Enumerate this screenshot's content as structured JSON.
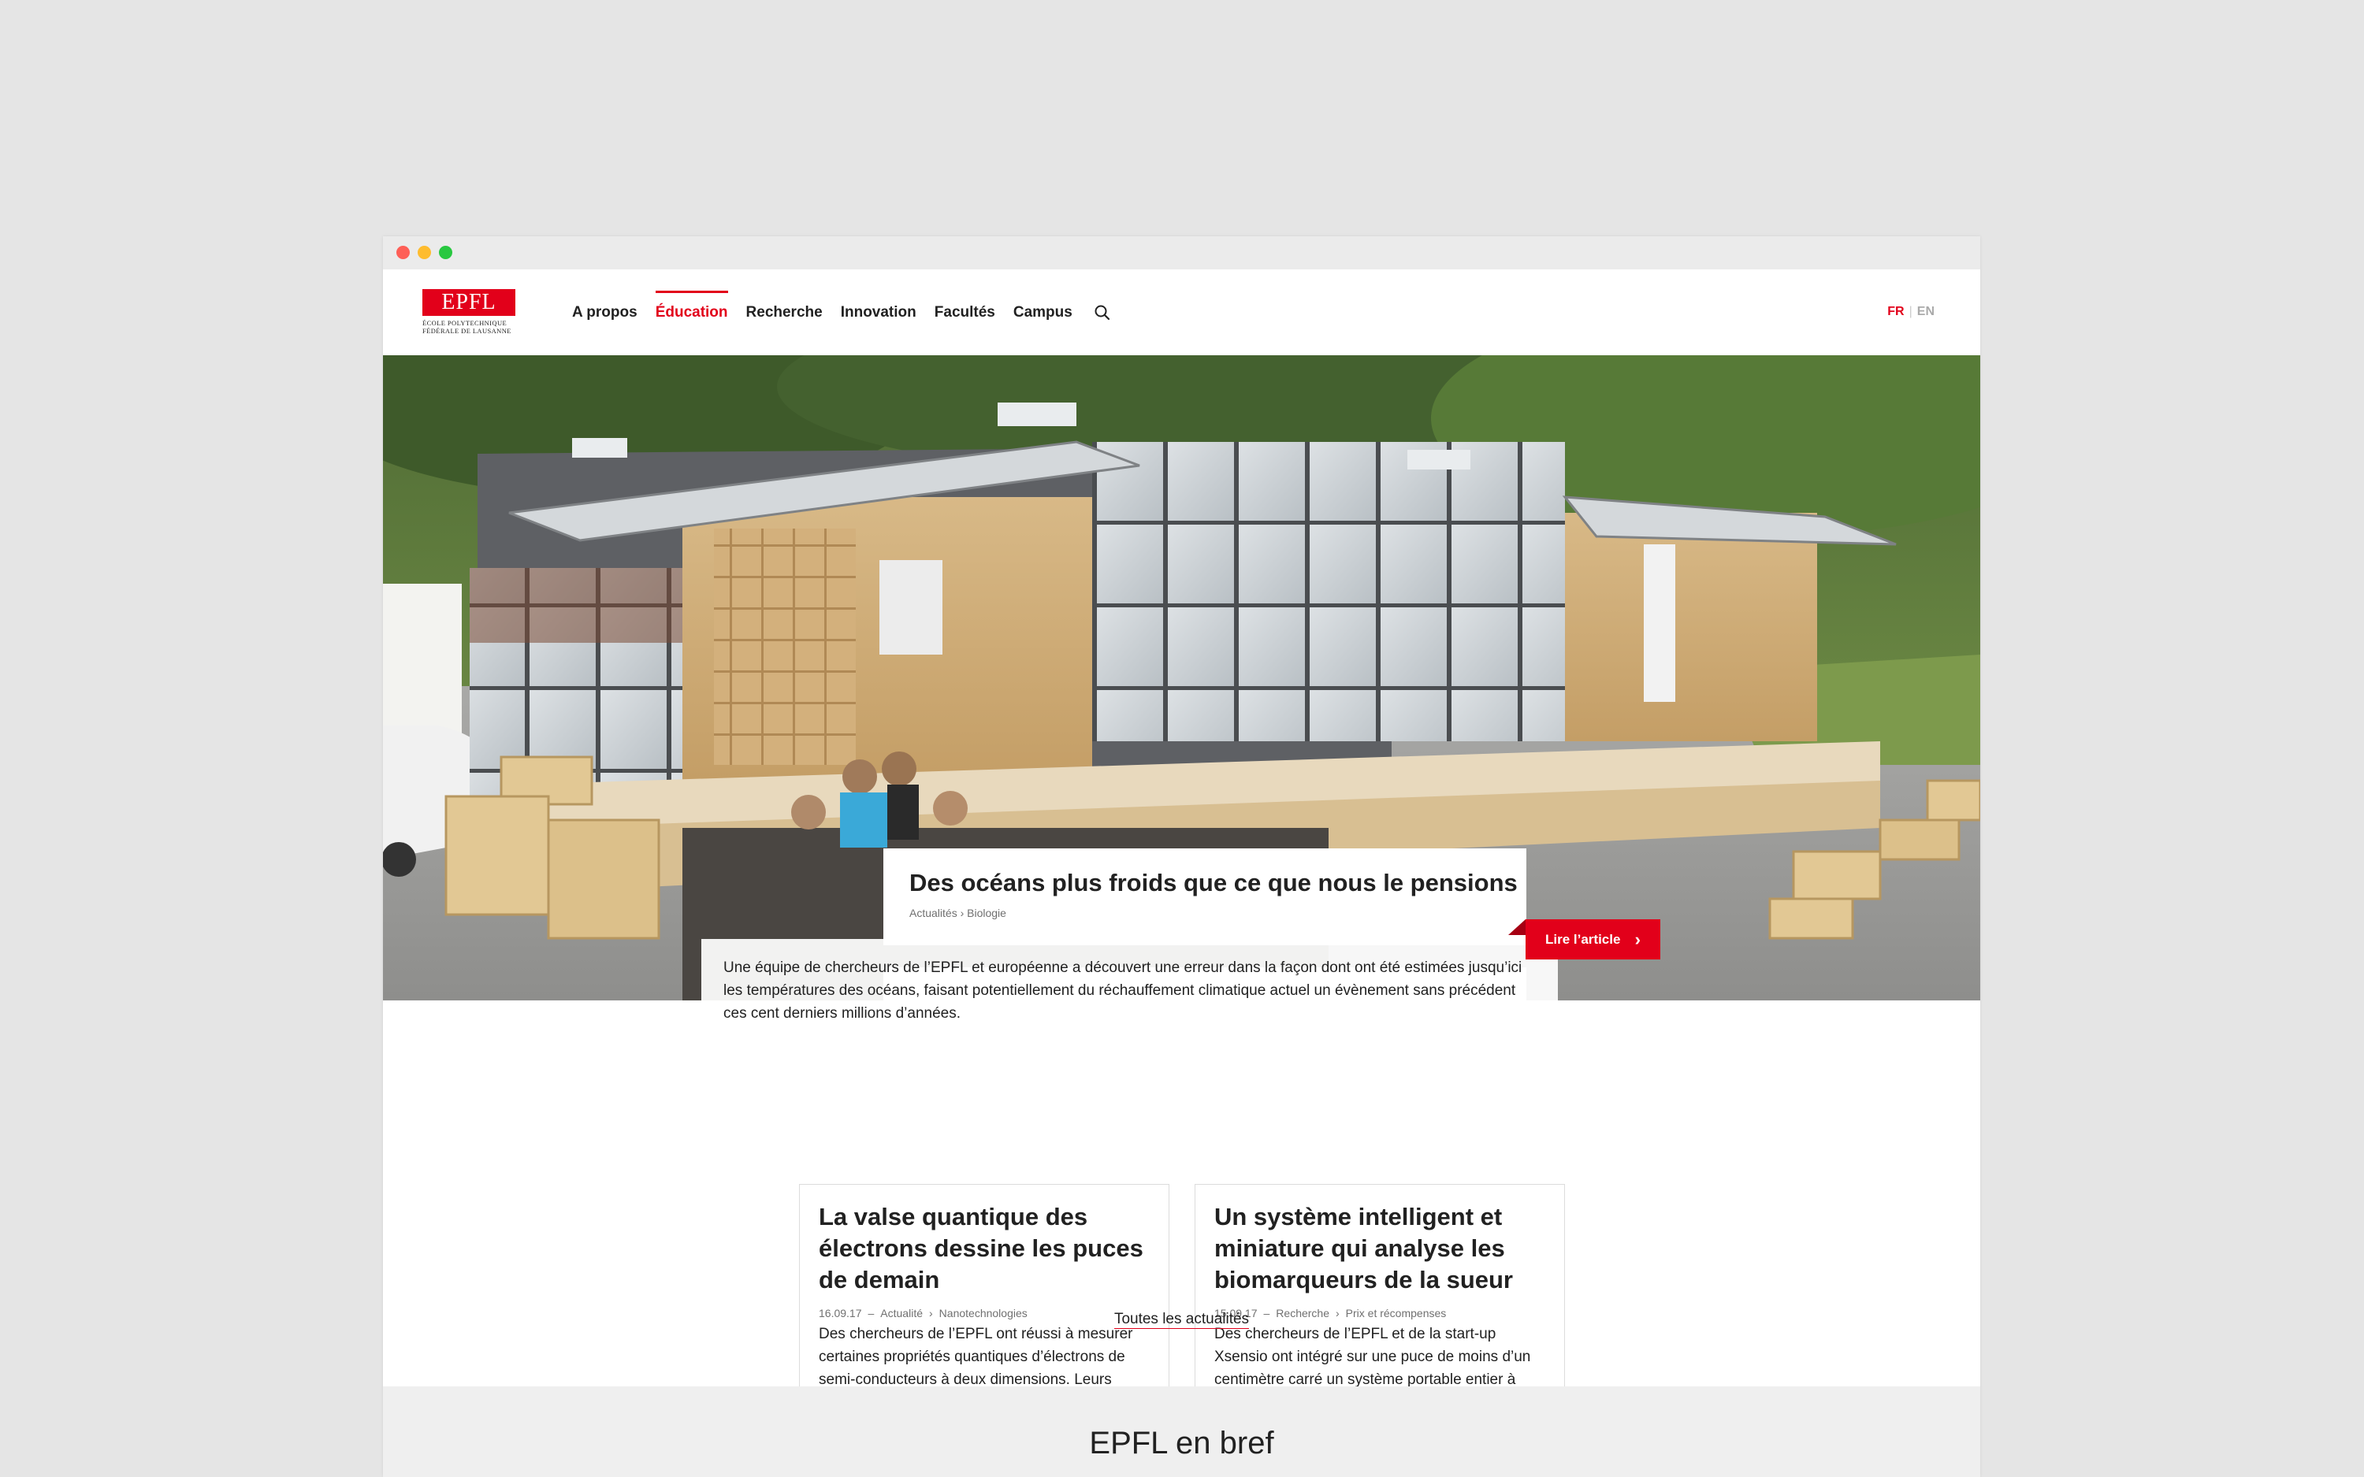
{
  "nav": {
    "logo_text": "EPFL",
    "logo_sub_1": "ÉCOLE POLYTECHNIQUE",
    "logo_sub_2": "FÉDÉRALE DE LAUSANNE",
    "items": [
      {
        "label": "A propos"
      },
      {
        "label": "Éducation"
      },
      {
        "label": "Recherche"
      },
      {
        "label": "Innovation"
      },
      {
        "label": "Facultés"
      },
      {
        "label": "Campus"
      }
    ],
    "active_item": "Éducation",
    "search_icon": "search-icon"
  },
  "lang": {
    "fr": "FR",
    "sep": "|",
    "en": "EN",
    "active": "FR"
  },
  "hero": {
    "title": "Des océans plus froids que ce que nous le pensions",
    "crumbs": "Actualités › Biologie",
    "excerpt": "Une équipe de chercheurs de l’EPFL et européenne a découvert une erreur dans la façon dont ont été estimées jusqu’ici les températures des océans, faisant potentiellement du réchauffement climatique actuel un évènement sans précédent ces cent derniers millions d’années.",
    "button": "Lire l’article"
  },
  "news": [
    {
      "title": "La valse quantique des électrons dessine les puces de demain",
      "date": "16.09.17",
      "dash": "–",
      "category": "Actualité",
      "arrow": "›",
      "tag": "Nanotechnologies",
      "text": "Des chercheurs de l’EPFL ont réussi à mesurer certaines propriétés quantiques d’électrons de semi-conducteurs à deux dimensions. Leurs travaux dans le domaine de la spintronique pourraient notamment aboutir à la fabrication de puces plus petites et dégageant moins de chaleur."
    },
    {
      "title": "Un système intelligent et miniature qui analyse les biomarqueurs de la sueur",
      "date": "15.09.17",
      "dash": "–",
      "category": "Recherche",
      "arrow": "›",
      "tag": "Prix et récompenses",
      "text": "Des chercheurs de l’EPFL et de la start-up Xsensio ont intégré sur une puce de moins d’un centimètre carré un système portable entier à faible énergie permettant l’encapsulation et l’analyse des biomarqueurs contenus dans la sueur."
    }
  ],
  "all_news": "Toutes les actualités",
  "brief": "EPFL en bref",
  "colors": {
    "accent": "#e2001a",
    "page_bg": "#e5e5e5"
  }
}
